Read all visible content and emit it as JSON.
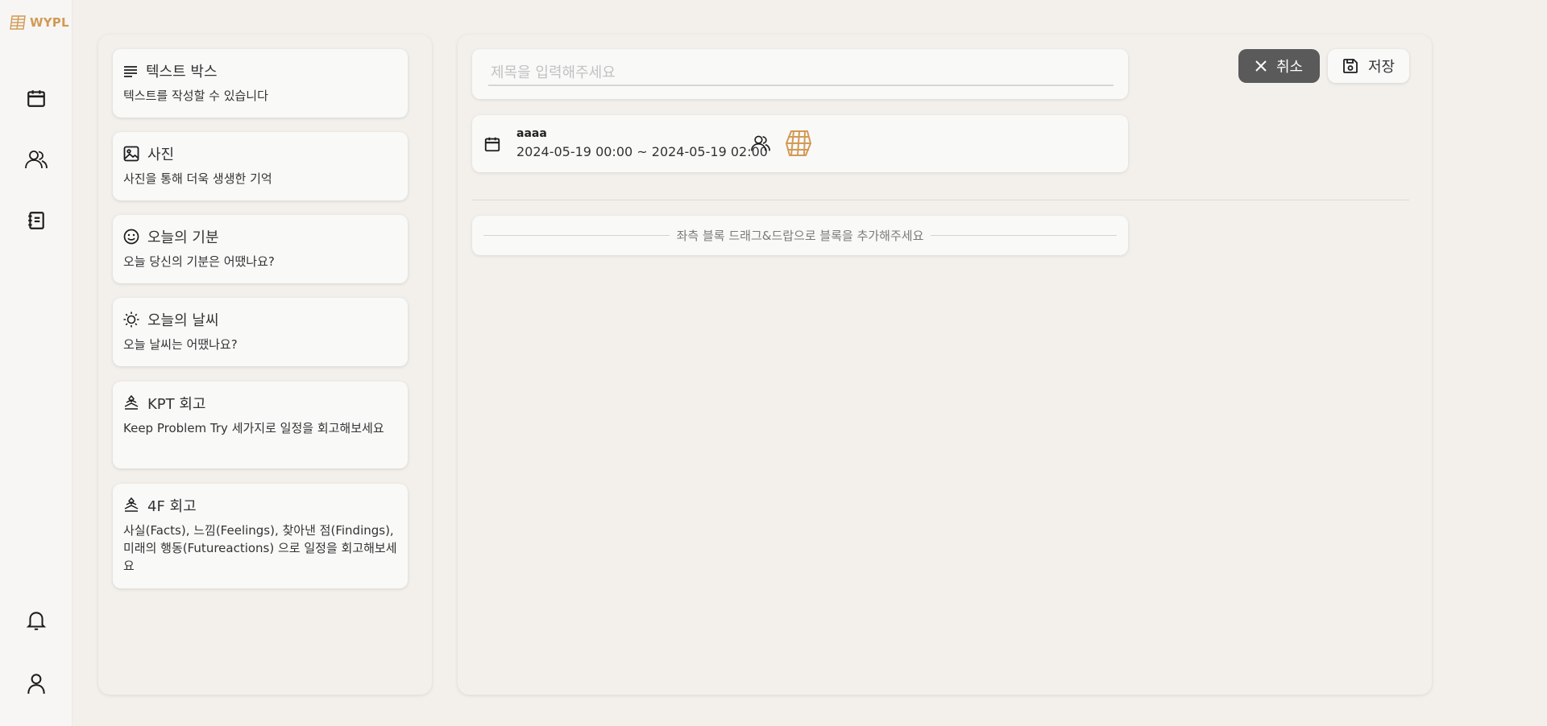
{
  "app": {
    "logo_text": "WYPL",
    "brand_color": "#d29a55"
  },
  "nav": {
    "items": [
      {
        "icon": "calendar-icon"
      },
      {
        "icon": "group-icon"
      },
      {
        "icon": "notebook-icon"
      }
    ],
    "bottom": [
      {
        "icon": "bell-icon"
      },
      {
        "icon": "user-icon"
      }
    ]
  },
  "blocks": [
    {
      "icon": "text-lines-icon",
      "title": "텍스트 박스",
      "desc": "텍스트를 작성할 수 있습니다"
    },
    {
      "icon": "image-icon",
      "title": "사진",
      "desc": "사진을 통해 더욱 생생한 기억"
    },
    {
      "icon": "smile-icon",
      "title": "오늘의 기분",
      "desc": "오늘 당신의 기분은 어땠나요?"
    },
    {
      "icon": "sun-icon",
      "title": "오늘의 날씨",
      "desc": "오늘 날씨는 어땠나요?"
    },
    {
      "icon": "retro-icon",
      "title": "KPT 회고",
      "desc": "Keep Problem Try 세가지로 일정을 회고해보세요"
    },
    {
      "icon": "retro-icon",
      "title": "4F 회고",
      "desc": "사실(Facts), 느낌(Feelings), 찾아낸 점(Findings), 미래의 행동(Futureactions) 으로 일정을 회고해보세요"
    }
  ],
  "editor": {
    "title_placeholder": "제목을 입력해주세요",
    "title_value": "",
    "schedule": {
      "name": "aaaa",
      "time": "2024-05-19 00:00 ~ 2024-05-19 02:00"
    },
    "drop_hint": "좌측 블록 드래그&드랍으로 블록을 추가해주세요",
    "cancel_label": "취소",
    "save_label": "저장",
    "cancel_color": "#5a5a5a"
  }
}
